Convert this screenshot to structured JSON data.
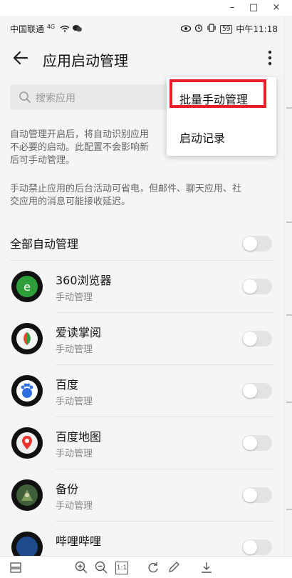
{
  "window": {
    "minimize_glyph": "–",
    "maximize_glyph": "□",
    "close_glyph": "×"
  },
  "status_bar": {
    "carrier": "中国联通",
    "network": "4G",
    "battery": "59",
    "time": "中午11:18"
  },
  "app_bar": {
    "title": "应用启动管理",
    "back_icon": "back-arrow-icon",
    "more_icon": "more-vertical-icon"
  },
  "search": {
    "placeholder": "搜索应用",
    "icon": "search-icon"
  },
  "description": {
    "line1": "自动管理开启后，将自动识别应用",
    "line2": "不必要的启动。此配置不会影响新",
    "line3": "后可手动管理。",
    "para2_line1": "手动禁止应用的后台活动可省电，但邮件、聊天应用、社",
    "para2_line2": "交应用的消息可能接收延迟。"
  },
  "all_auto": {
    "label": "全部自动管理",
    "enabled": false
  },
  "apps": [
    {
      "name": "360浏览器",
      "mode": "手动管理",
      "enabled": false,
      "icon_color": "#2e9e3a"
    },
    {
      "name": "爱读掌阅",
      "mode": "手动管理",
      "enabled": false,
      "icon_color": "#f5f5f5"
    },
    {
      "name": "百度",
      "mode": "手动管理",
      "enabled": false,
      "icon_color": "#2f6fe0"
    },
    {
      "name": "百度地图",
      "mode": "手动管理",
      "enabled": false,
      "icon_color": "#f0f0f0"
    },
    {
      "name": "备份",
      "mode": "手动管理",
      "enabled": false,
      "icon_color": "#3f5f3a"
    },
    {
      "name": "哔哩哔哩",
      "mode": "",
      "enabled": false,
      "icon_color": "#1c4a8a"
    }
  ],
  "menu": {
    "items": [
      {
        "label": "批量手动管理",
        "highlighted": true
      },
      {
        "label": "启动记录",
        "highlighted": false
      }
    ],
    "highlight_color": "#e8202a"
  },
  "toolbar": {
    "tools": [
      "layout-icon",
      "zoom-in-icon",
      "zoom-out-icon",
      "actual-size-icon",
      "rotate-icon",
      "edit-icon",
      "download-icon"
    ],
    "actual_size_label": "1:1"
  }
}
